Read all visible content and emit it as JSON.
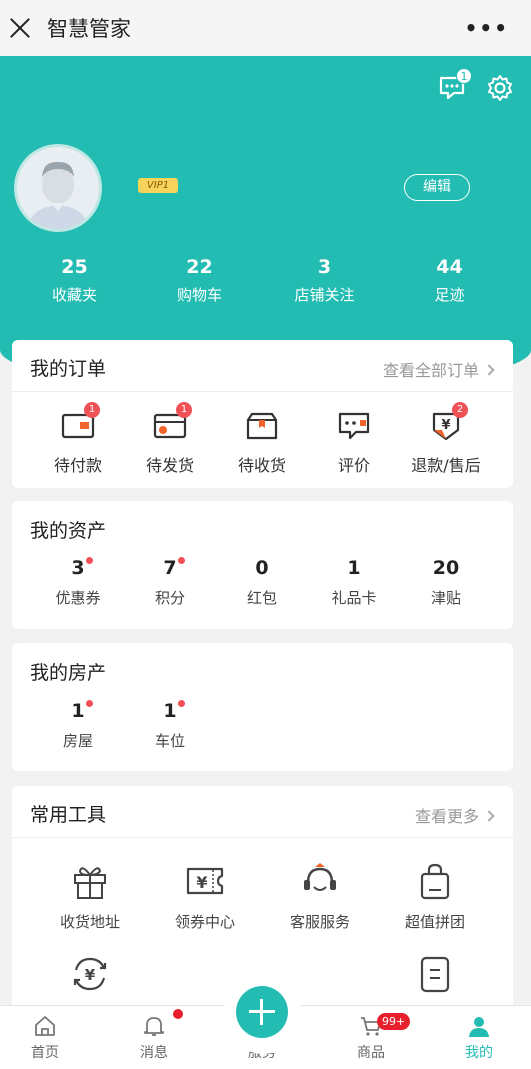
{
  "app": {
    "title": "智慧管家",
    "more": "•••"
  },
  "header": {
    "msg_badge": "1",
    "vip_label": "VIP1",
    "edit_label": "编辑",
    "accent_color": "#23bcb2"
  },
  "stats": [
    {
      "value": "25",
      "label": "收藏夹"
    },
    {
      "value": "22",
      "label": "购物车"
    },
    {
      "value": "3",
      "label": "店铺关注"
    },
    {
      "value": "44",
      "label": "足迹"
    }
  ],
  "orders": {
    "title": "我的订单",
    "more": "查看全部订单",
    "items": [
      {
        "label": "待付款",
        "badge": "1",
        "icon": "wallet-icon"
      },
      {
        "label": "待发货",
        "badge": "1",
        "icon": "card-icon"
      },
      {
        "label": "待收货",
        "badge": "",
        "icon": "box-icon"
      },
      {
        "label": "评价",
        "badge": "",
        "icon": "comment-icon"
      },
      {
        "label": "退款/售后",
        "badge": "2",
        "icon": "refund-icon"
      }
    ]
  },
  "assets": {
    "title": "我的资产",
    "items": [
      {
        "value": "3",
        "label": "优惠券",
        "dot": true
      },
      {
        "value": "7",
        "label": "积分",
        "dot": true
      },
      {
        "value": "0",
        "label": "红包",
        "dot": false
      },
      {
        "value": "1",
        "label": "礼品卡",
        "dot": false
      },
      {
        "value": "20",
        "label": "津贴",
        "dot": false
      }
    ]
  },
  "property": {
    "title": "我的房产",
    "items": [
      {
        "value": "1",
        "label": "房屋",
        "dot": true
      },
      {
        "value": "1",
        "label": "车位",
        "dot": true
      }
    ]
  },
  "tools": {
    "title": "常用工具",
    "more": "查看更多",
    "items": [
      {
        "label": "收货地址",
        "icon": "gift-icon"
      },
      {
        "label": "领券中心",
        "icon": "coupon-icon"
      },
      {
        "label": "客服服务",
        "icon": "headset-icon"
      },
      {
        "label": "超值拼团",
        "icon": "bag-icon"
      }
    ]
  },
  "nav": {
    "items": [
      {
        "label": "首页",
        "icon": "home-icon"
      },
      {
        "label": "消息",
        "icon": "bell-icon"
      },
      {
        "label": "服务",
        "icon": "plus-icon"
      },
      {
        "label": "商品",
        "icon": "cart-icon"
      },
      {
        "label": "我的",
        "icon": "user-icon"
      }
    ],
    "cart_badge": "99+"
  }
}
